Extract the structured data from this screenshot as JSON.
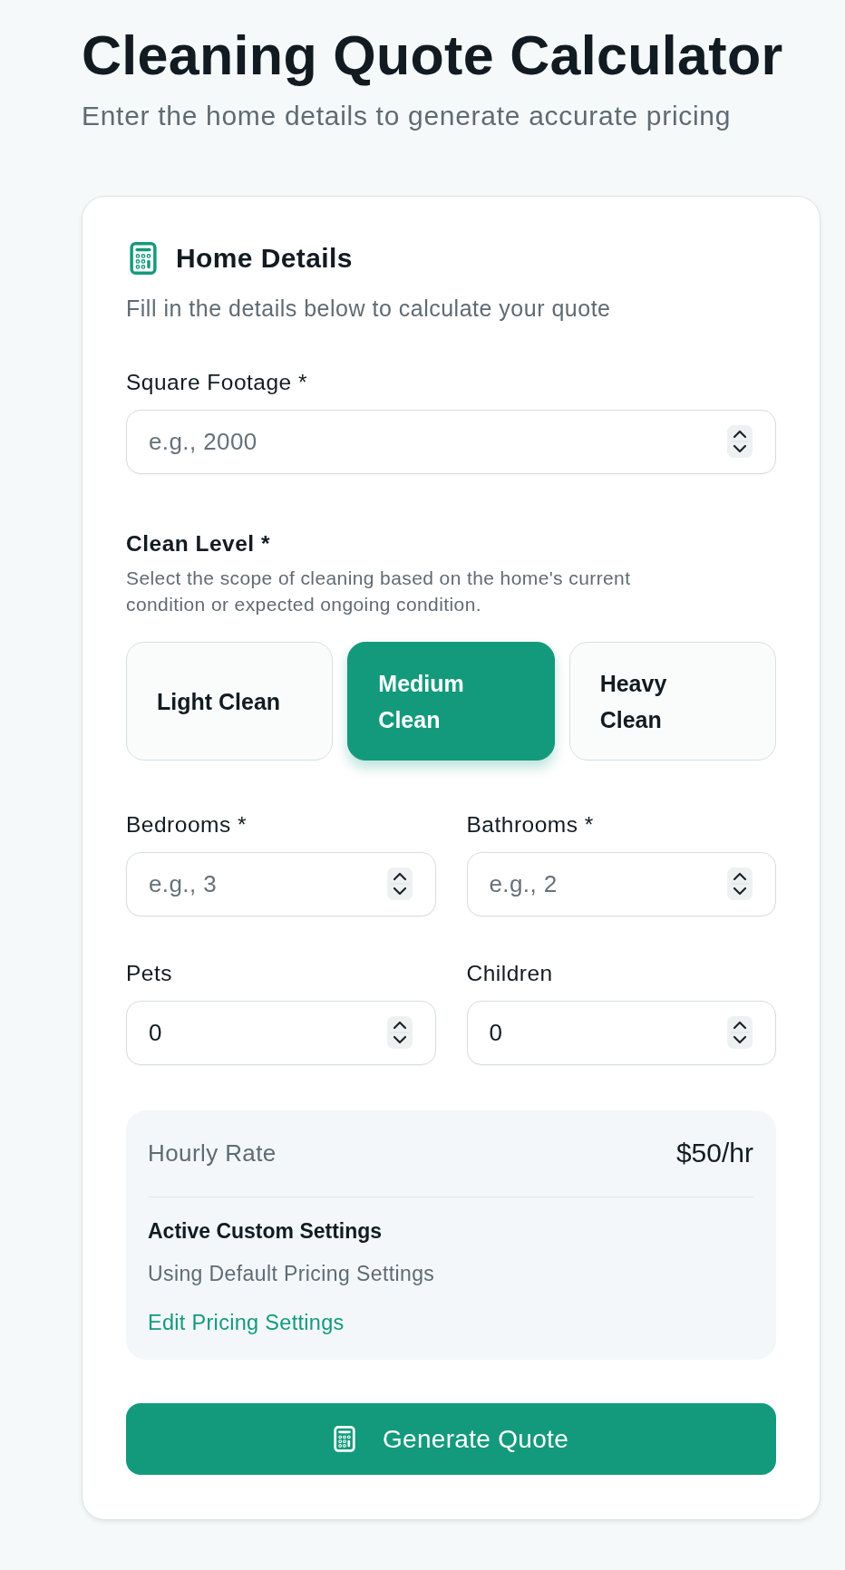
{
  "header": {
    "title": "Cleaning Quote Calculator",
    "subtitle": "Enter the home details to generate accurate pricing"
  },
  "card": {
    "title": "Home Details",
    "description": "Fill in the details below to calculate your quote"
  },
  "square_footage": {
    "label": "Square Footage *",
    "placeholder": "e.g., 2000"
  },
  "clean_level": {
    "label": "Clean Level *",
    "help": "Select the scope of cleaning based on the home's current condition or expected ongoing condition.",
    "options": [
      {
        "label": "Light Clean",
        "selected": false
      },
      {
        "label": "Medium Clean",
        "selected": true
      },
      {
        "label": "Heavy Clean",
        "selected": false
      }
    ]
  },
  "counts": [
    {
      "label": "Bedrooms *",
      "placeholder": "e.g., 3"
    },
    {
      "label": "Bathrooms *",
      "placeholder": "e.g., 2"
    },
    {
      "label": "Pets",
      "value": "0"
    },
    {
      "label": "Children",
      "value": "0"
    }
  ],
  "pricing": {
    "rate_label": "Hourly Rate",
    "rate_value": "$50/hr",
    "settings_title": "Active Custom Settings",
    "settings_status": "Using Default Pricing Settings",
    "edit_link": "Edit Pricing Settings"
  },
  "primary_button": {
    "label": "Generate Quote"
  }
}
